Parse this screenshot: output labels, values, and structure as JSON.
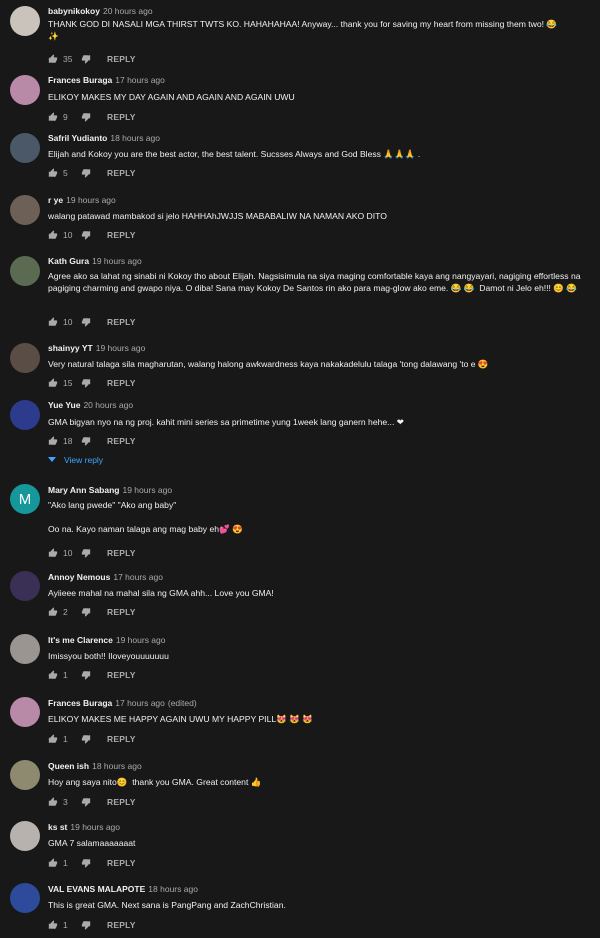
{
  "reply_label": "REPLY",
  "comments": [
    {
      "author": "babynikokoy",
      "time": "20 hours ago",
      "edited": "",
      "text": "THANK GOD DI NASALI MGA THIRST TWTS KO. HAHAHAHAA! Anyway... thank you for saving my heart from missing them two! 😂\n✨",
      "likes": "35",
      "avatar": {
        "color": "#c9c3bb",
        "letter": ""
      }
    },
    {
      "author": "Frances Buraga",
      "time": "17 hours ago",
      "edited": "",
      "text": "ELIKOY MAKES MY DAY AGAIN AND AGAIN AND AGAIN UWU",
      "likes": "9",
      "avatar": {
        "color": "#b88aa8",
        "letter": ""
      }
    },
    {
      "author": "Safril Yudianto",
      "time": "18 hours ago",
      "edited": "",
      "text": "Elijah and Kokoy you are the best actor, the best talent. Sucsses Always and God Bless 🙏🙏🙏 .",
      "likes": "5",
      "avatar": {
        "color": "#4a5868",
        "letter": ""
      }
    },
    {
      "author": "r ye",
      "time": "19 hours ago",
      "edited": "",
      "text": "walang patawad mambakod si jelo HAHHAhJWJJS MABABALIW NA NAMAN AKO DITO",
      "likes": "10",
      "avatar": {
        "color": "#6d6056",
        "letter": ""
      }
    },
    {
      "author": "Kath Gura",
      "time": "19 hours ago",
      "edited": "",
      "text": "Agree ako sa lahat ng sinabi ni Kokoy tho about Elijah. Nagsisimula na siya maging comfortable kaya ang nangyayari, nagiging effortless na pagiging charming and gwapo niya. O diba! Sana may Kokoy De Santos rin ako para mag-glow ako eme. 😂 😂  Damot ni Jelo eh!!! 😊 😂",
      "likes": "10",
      "avatar": {
        "color": "#5b6b52",
        "letter": ""
      }
    },
    {
      "author": "shainyy YT",
      "time": "19 hours ago",
      "edited": "",
      "text": "Very natural talaga sila magharutan, walang halong awkwardness kaya nakakadelulu talaga 'tong dalawang 'to e 😍",
      "likes": "15",
      "avatar": {
        "color": "#5a4d45",
        "letter": ""
      }
    },
    {
      "author": "Yue Yue",
      "time": "20 hours ago",
      "edited": "",
      "text": "GMA bigyan nyo na ng proj. kahit mini series sa primetime yung 1week lang ganern hehe... ❤",
      "likes": "18",
      "avatar": {
        "color": "#2c3b8c",
        "letter": ""
      }
    },
    {
      "author": "Mary Ann Sabang",
      "time": "19 hours ago",
      "edited": "",
      "text": "\"Ako lang pwede\" \"Ako ang baby\"\n\nOo na. Kayo naman talaga ang mag baby eh💕 😍",
      "likes": "10",
      "avatar": {
        "color": "#15979c",
        "letter": "M"
      }
    },
    {
      "author": "Annoy Nemous",
      "time": "17 hours ago",
      "edited": "",
      "text": "Ayiieee mahal na mahal sila ng GMA ahh... Love you GMA!",
      "likes": "2",
      "avatar": {
        "color": "#3a2f55",
        "letter": ""
      }
    },
    {
      "author": "It's me Clarence",
      "time": "19 hours ago",
      "edited": "",
      "text": "Imissyou both!! Iloveyouuuuuuu",
      "likes": "1",
      "avatar": {
        "color": "#9b9591",
        "letter": ""
      }
    },
    {
      "author": "Frances Buraga",
      "time": "17 hours ago",
      "edited": "(edited)",
      "text": "ELIKOY MAKES ME HAPPY AGAIN UWU MY HAPPY PILL😻 😻 😻",
      "likes": "1",
      "avatar": {
        "color": "#b88aa8",
        "letter": ""
      }
    },
    {
      "author": "Queen ish",
      "time": "18 hours ago",
      "edited": "",
      "text": "Hoy ang saya nito😊  thank you GMA. Great content 👍",
      "likes": "3",
      "avatar": {
        "color": "#8d8a6f",
        "letter": ""
      }
    },
    {
      "author": "ks st",
      "time": "19 hours ago",
      "edited": "",
      "text": "GMA 7 salamaaaaaaat",
      "likes": "1",
      "avatar": {
        "color": "#b7b2ae",
        "letter": ""
      }
    },
    {
      "author": "VAL EVANS MALAPOTE",
      "time": "18 hours ago",
      "edited": "",
      "text": "This is great GMA. Next sana is PangPang and ZachChristian.",
      "likes": "1",
      "avatar": {
        "color": "#2d4b9a",
        "letter": ""
      }
    }
  ],
  "view_reply": {
    "label": "View reply"
  }
}
